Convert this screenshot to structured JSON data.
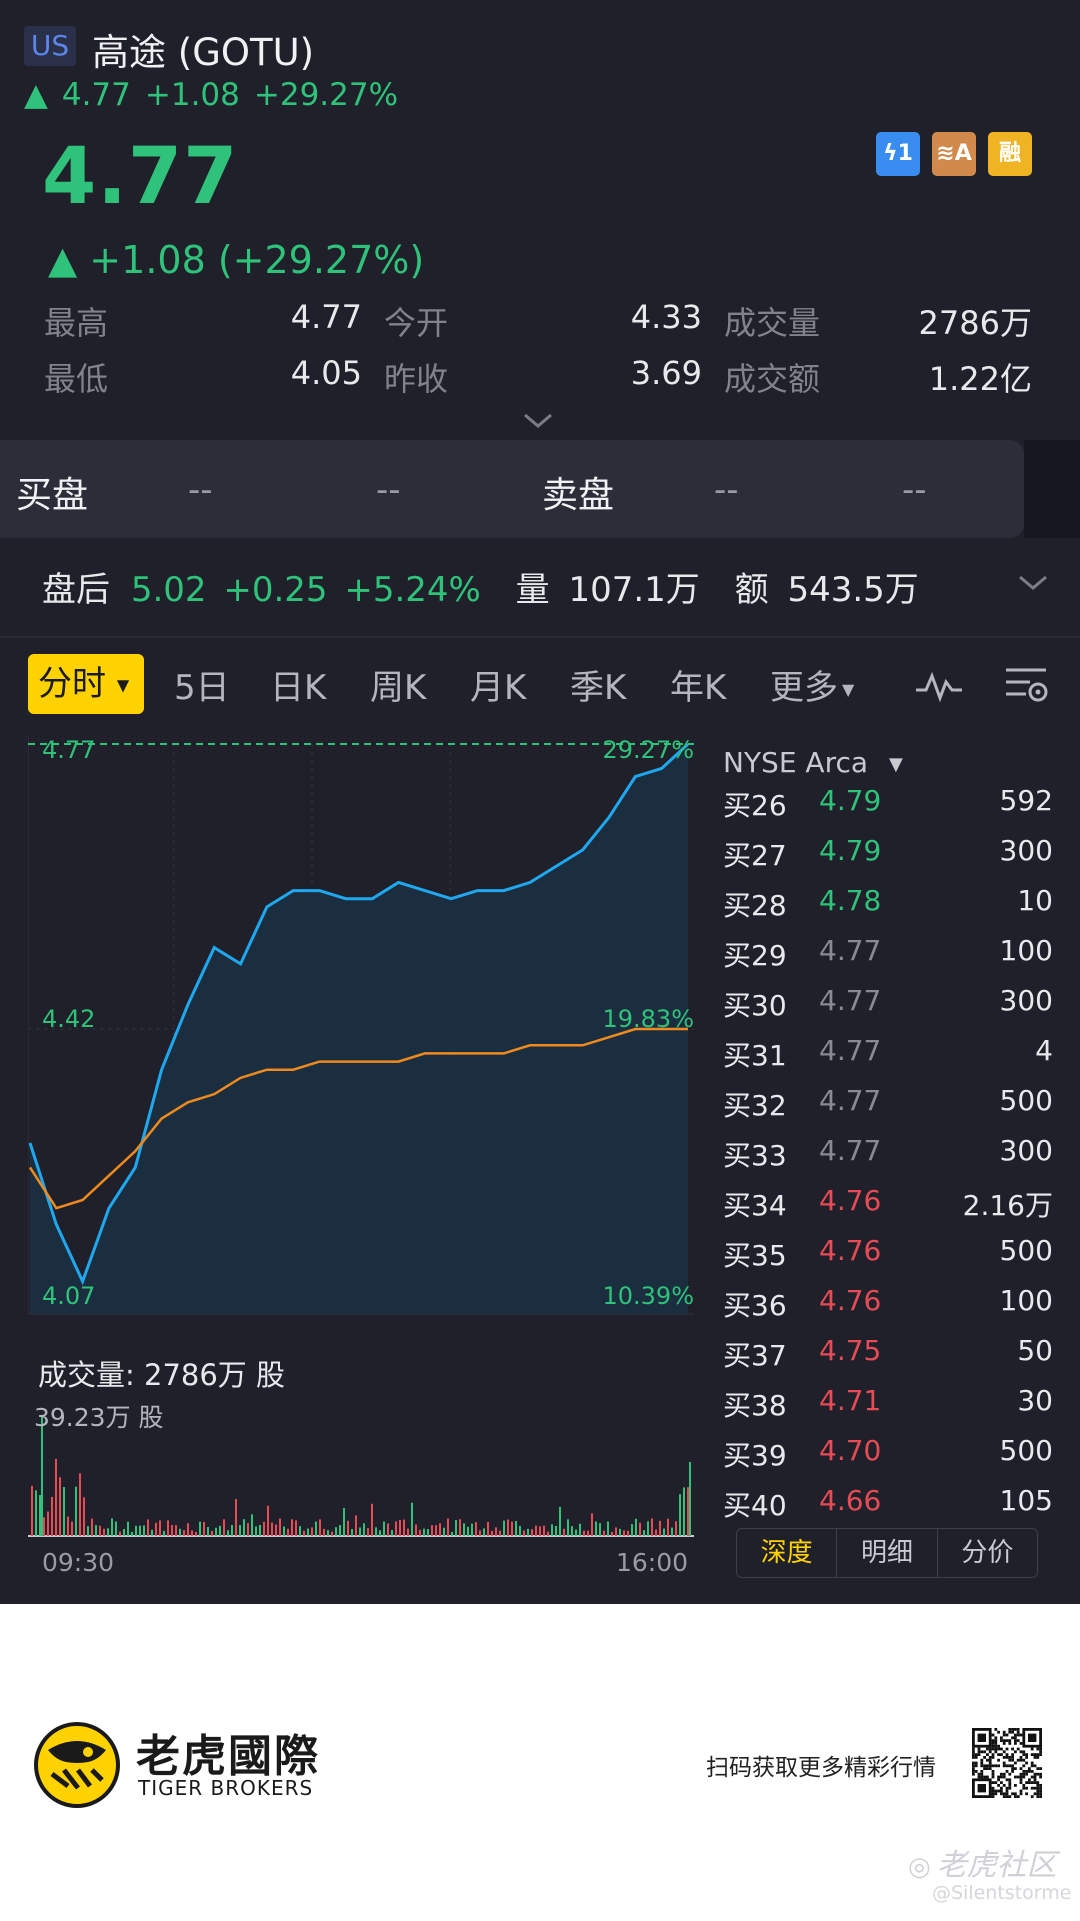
{
  "header": {
    "market_badge": "US",
    "name": "高途 (GOTU)",
    "quote_arrow": "▲",
    "quote_price": "4.77",
    "quote_change": "+1.08",
    "quote_pct": "+29.27%",
    "price": "4.77",
    "change_line": "▲ +1.08 (+29.27%)",
    "badges": [
      {
        "name": "lightning-badge",
        "text": "ϟ1",
        "color": "#3a8df0"
      },
      {
        "name": "layers-badge",
        "text": "≋A",
        "color": "#d28a4c"
      },
      {
        "name": "margin-badge",
        "text": "融",
        "color": "#f0b323"
      }
    ]
  },
  "stats": [
    {
      "label": "最高",
      "value": "4.77"
    },
    {
      "label": "今开",
      "value": "4.33"
    },
    {
      "label": "成交量",
      "value": "2786万"
    },
    {
      "label": "最低",
      "value": "4.05"
    },
    {
      "label": "昨收",
      "value": "3.69"
    },
    {
      "label": "成交额",
      "value": "1.22亿"
    }
  ],
  "orderbook": {
    "bid_label": "买盘",
    "bid_price": "--",
    "bid_size": "--",
    "ask_label": "卖盘",
    "ask_price": "--",
    "ask_size": "--"
  },
  "after_hours": {
    "label": "盘后",
    "price": "5.02",
    "change": "+0.25",
    "pct": "+5.24%",
    "vol_label": "量",
    "vol": "107.1万",
    "amt_label": "额",
    "amt": "543.5万"
  },
  "tabs": [
    "分时",
    "5日",
    "日K",
    "周K",
    "月K",
    "季K",
    "年K",
    "更多"
  ],
  "chart": {
    "price_high": "4.77",
    "price_mid": "4.42",
    "price_low": "4.07",
    "pct_high": "29.27%",
    "pct_mid": "19.83%",
    "pct_low": "10.39%",
    "volume_title": "成交量:  2786万 股",
    "volume_max": "39.23万 股",
    "time_start": "09:30",
    "time_end": "16:00",
    "colors": {
      "price_line": "#1fa8f0",
      "avg_line": "#f08a1e",
      "up": "#2fc27a",
      "down": "#e74b56"
    }
  },
  "chart_data": {
    "type": "line",
    "title": "",
    "xlabel": "",
    "ylabel": "",
    "x_range": [
      "09:30",
      "16:00"
    ],
    "ylim": [
      4.07,
      4.77
    ],
    "series": [
      {
        "values": [
          4.28,
          4.18,
          4.11,
          4.2,
          4.25,
          4.37,
          4.45,
          4.52,
          4.5,
          4.57,
          4.59,
          4.59,
          4.58,
          4.58,
          4.6,
          4.59,
          4.58,
          4.59,
          4.59,
          4.6,
          4.62,
          4.64,
          4.68,
          4.73,
          4.74,
          4.77
        ]
      },
      {
        "values": [
          4.25,
          4.2,
          4.21,
          4.24,
          4.27,
          4.31,
          4.33,
          4.34,
          4.36,
          4.37,
          4.37,
          4.38,
          4.38,
          4.38,
          4.38,
          4.39,
          4.39,
          4.39,
          4.39,
          4.4,
          4.4,
          4.4,
          4.41,
          4.42,
          4.42,
          4.42
        ]
      }
    ]
  },
  "side_panel": {
    "exchange": "NYSE Arca",
    "rows": [
      {
        "label": "买26",
        "price": "4.79",
        "size": "592",
        "color": "#2fc27a"
      },
      {
        "label": "买27",
        "price": "4.79",
        "size": "300",
        "color": "#2fc27a"
      },
      {
        "label": "买28",
        "price": "4.78",
        "size": "10",
        "color": "#2fc27a"
      },
      {
        "label": "买29",
        "price": "4.77",
        "size": "100",
        "color": "#888a94"
      },
      {
        "label": "买30",
        "price": "4.77",
        "size": "300",
        "color": "#888a94"
      },
      {
        "label": "买31",
        "price": "4.77",
        "size": "4",
        "color": "#888a94"
      },
      {
        "label": "买32",
        "price": "4.77",
        "size": "500",
        "color": "#888a94"
      },
      {
        "label": "买33",
        "price": "4.77",
        "size": "300",
        "color": "#888a94"
      },
      {
        "label": "买34",
        "price": "4.76",
        "size": "2.16万",
        "color": "#e74b56"
      },
      {
        "label": "买35",
        "price": "4.76",
        "size": "500",
        "color": "#e74b56"
      },
      {
        "label": "买36",
        "price": "4.76",
        "size": "100",
        "color": "#e74b56"
      },
      {
        "label": "买37",
        "price": "4.75",
        "size": "50",
        "color": "#e74b56"
      },
      {
        "label": "买38",
        "price": "4.71",
        "size": "30",
        "color": "#e74b56"
      },
      {
        "label": "买39",
        "price": "4.70",
        "size": "500",
        "color": "#e74b56"
      },
      {
        "label": "买40",
        "price": "4.66",
        "size": "105",
        "color": "#e74b56"
      }
    ],
    "segments": [
      "深度",
      "明细",
      "分价"
    ]
  },
  "footer": {
    "brand_cn": "老虎國際",
    "brand_en": "TIGER BROKERS",
    "scan_text": "扫码获取更多精彩行情",
    "watermark": "老虎社区",
    "watermark_user": "@Silentstorme"
  }
}
